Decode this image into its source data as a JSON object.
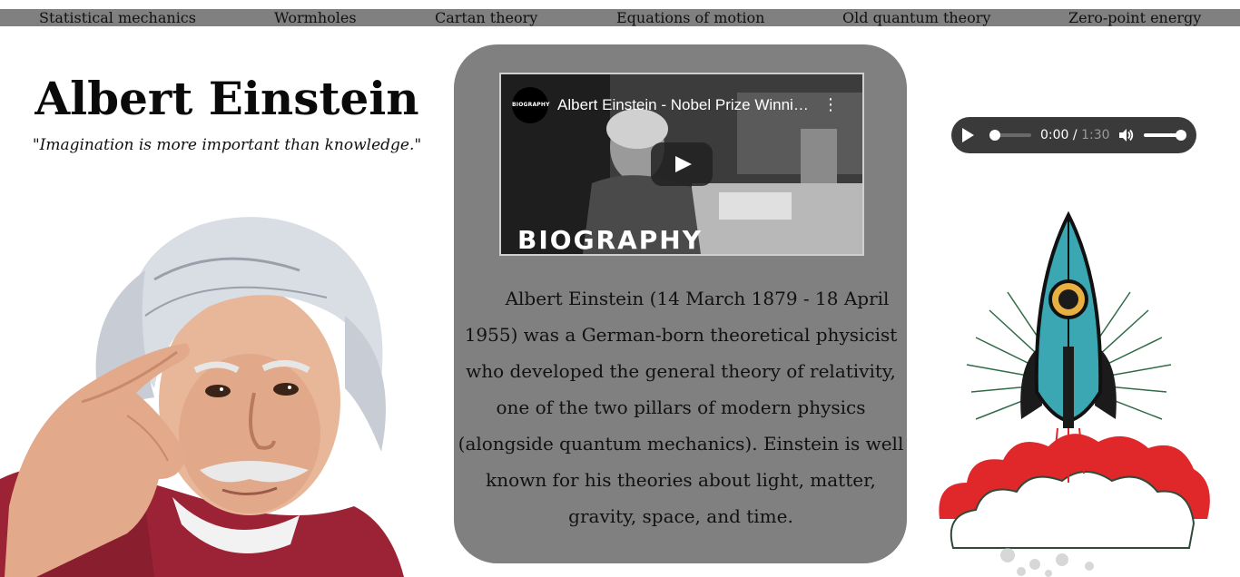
{
  "nav": {
    "links": [
      "Statistical mechanics",
      "Wormholes",
      "Cartan theory",
      "Equations of motion",
      "Old quantum theory",
      "Zero-point energy"
    ]
  },
  "header": {
    "title": "Albert Einstein",
    "quote": "\"Imagination is more important than knowledge.\""
  },
  "video": {
    "channel_logo": "BIOGRAPHY",
    "title": "Albert Einstein - Nobel Prize Winning Physicist",
    "brand": "BIOGRAPHY",
    "play_icon": "play-icon",
    "menu_icon": "more-vert-icon"
  },
  "bio": {
    "text": "Albert Einstein (14 March 1879 - 18 April 1955) was a German-born theoretical physicist who developed the general theory of relativity, one of the two pillars of modern physics (alongside quantum mechanics). Einstein is well known for his theories about light, matter, gravity, space, and time."
  },
  "audio": {
    "current_time": "0:00",
    "duration": "1:30",
    "progress": 0,
    "volume": 1
  },
  "colors": {
    "navbar": "#808080",
    "panel": "#808080",
    "rocket_body": "#3aa7b3",
    "smoke_red": "#e0282a"
  }
}
